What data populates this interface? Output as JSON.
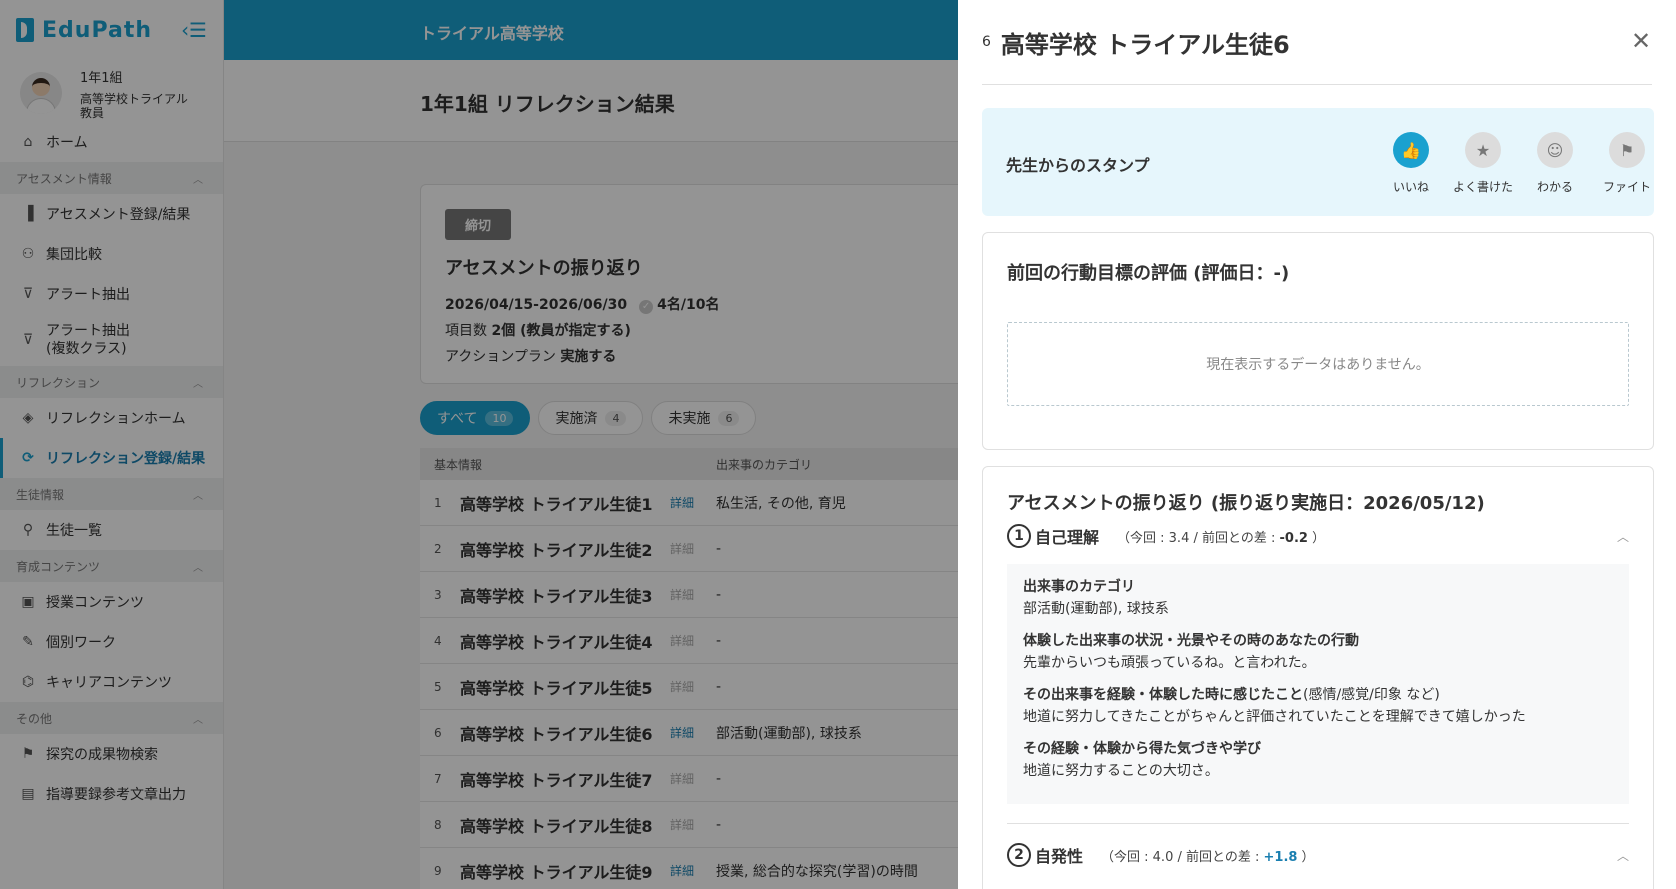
{
  "app": {
    "logo": "EduPath",
    "school": "トライアル高等学校"
  },
  "user": {
    "class": "1年1組",
    "role_line1": "高等学校トライアル",
    "role_line2": "教員"
  },
  "sidebar": {
    "home": "ホーム",
    "sections": [
      {
        "title": "アセスメント情報",
        "items": [
          "アセスメント登録/結果",
          "集団比較",
          "アラート抽出",
          "アラート抽出",
          "(複数クラス)"
        ]
      },
      {
        "title": "リフレクション",
        "items": [
          "リフレクションホーム",
          "リフレクション登録/結果"
        ]
      },
      {
        "title": "生徒情報",
        "items": [
          "生徒一覧"
        ]
      },
      {
        "title": "育成コンテンツ",
        "items": [
          "授業コンテンツ",
          "個別ワーク",
          "キャリアコンテンツ"
        ]
      },
      {
        "title": "その他",
        "items": [
          "探究の成果物検索",
          "指導要録参考文章出力"
        ]
      }
    ]
  },
  "page": {
    "title": "1年1組 リフレクション結果"
  },
  "card": {
    "badge": "締切",
    "title": "アセスメントの振り返り",
    "period": "2026/04/15-2026/06/30",
    "done": "4名/10名",
    "items_label": "項目数",
    "items_value": "2個 (教員が指定する)",
    "action_label": "アクションプラン",
    "action_value": "実施する"
  },
  "tabs": [
    {
      "label": "すべて",
      "count": "10"
    },
    {
      "label": "実施済",
      "count": "4"
    },
    {
      "label": "未実施",
      "count": "6"
    }
  ],
  "table": {
    "headers": [
      "基本情報",
      "出来事のカテゴリ"
    ],
    "detail_label": "詳細",
    "rows": [
      {
        "no": "1",
        "name": "高等学校 トライアル生徒1",
        "category": "私生活, その他, 育児"
      },
      {
        "no": "2",
        "name": "高等学校 トライアル生徒2",
        "category": "-"
      },
      {
        "no": "3",
        "name": "高等学校 トライアル生徒3",
        "category": "-"
      },
      {
        "no": "4",
        "name": "高等学校 トライアル生徒4",
        "category": "-"
      },
      {
        "no": "5",
        "name": "高等学校 トライアル生徒5",
        "category": "-"
      },
      {
        "no": "6",
        "name": "高等学校 トライアル生徒6",
        "category": "部活動(運動部), 球技系"
      },
      {
        "no": "7",
        "name": "高等学校 トライアル生徒7",
        "category": "-"
      },
      {
        "no": "8",
        "name": "高等学校 トライアル生徒8",
        "category": "-"
      },
      {
        "no": "9",
        "name": "高等学校 トライアル生徒9",
        "category": "授業, 総合的な探究(学習)の時間"
      }
    ]
  },
  "panel": {
    "number": "6",
    "title": "高等学校 トライアル生徒6",
    "stamp_label": "先生からのスタンプ",
    "stamps": [
      "いいね",
      "よく書けた",
      "わかる",
      "ファイト"
    ],
    "eval_title": "前回の行動目標の評価 (評価日：-)",
    "empty_message": "現在表示するデータはありません。",
    "reflection_title": "アセスメントの振り返り (振り返り実施日：2026/05/12)",
    "q1": {
      "num": "1",
      "name": "自己理解",
      "meta_prefix": "（今回 : 3.4 / 前回との差 : ",
      "diff": "-0.2",
      "meta_suffix": " ）",
      "h1": "出来事のカテゴリ",
      "a1": "部活動(運動部), 球技系",
      "h2": "体験した出来事の状況・光景やその時のあなたの行動",
      "a2": "先輩からいつも頑張っているね。と言われた。",
      "h3": "その出来事を経験・体験した時に感じたこと",
      "h3_sub": "(感情/感覚/印象 など)",
      "a3": "地道に努力してきたことがちゃんと評価されていたことを理解できて嬉しかった",
      "h4": "その経験・体験から得た気づきや学び",
      "a4": "地道に努力することの大切さ。"
    },
    "q2": {
      "num": "2",
      "name": "自発性",
      "meta_prefix": "（今回 : 4.0 / 前回との差 : ",
      "diff": "+1.8",
      "meta_suffix": " ）"
    }
  },
  "colors": {
    "accent": "#1aa1cf",
    "stamp_bg": "#e6f6fc"
  }
}
